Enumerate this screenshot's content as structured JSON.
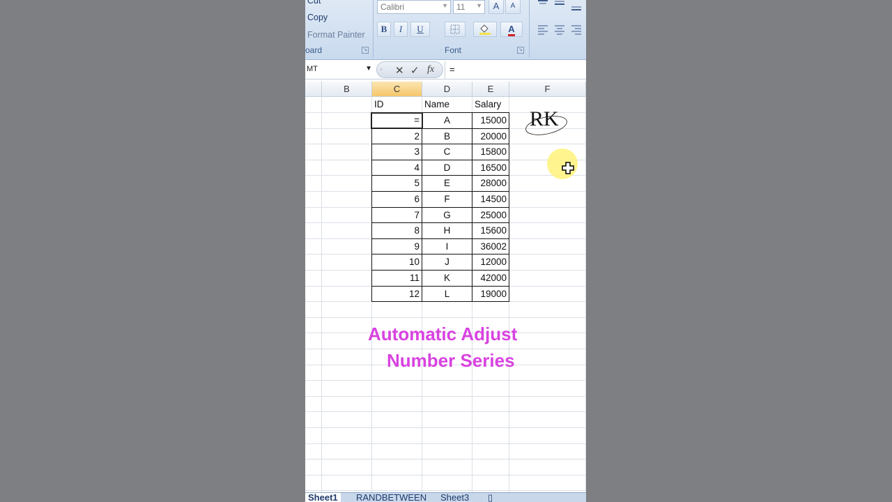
{
  "ribbon": {
    "clipboard": {
      "cut": "Cut",
      "copy": "Copy",
      "format_painter": "Format Painter",
      "group_label": "oard"
    },
    "font": {
      "font_name": "Calibri",
      "font_size": "11",
      "bold": "B",
      "italic": "I",
      "underline": "U",
      "group_label": "Font"
    }
  },
  "formula_bar": {
    "name_box": "MT",
    "formula": "="
  },
  "columns": [
    "B",
    "C",
    "D",
    "E",
    "F"
  ],
  "active_column": "C",
  "table": {
    "headers": [
      "ID",
      "Name",
      "Salary"
    ],
    "rows": [
      [
        "=",
        "A",
        "15000"
      ],
      [
        "2",
        "B",
        "20000"
      ],
      [
        "3",
        "C",
        "15800"
      ],
      [
        "4",
        "D",
        "16500"
      ],
      [
        "5",
        "E",
        "28000"
      ],
      [
        "6",
        "F",
        "14500"
      ],
      [
        "7",
        "G",
        "25000"
      ],
      [
        "8",
        "H",
        "15600"
      ],
      [
        "9",
        "I",
        "36002"
      ],
      [
        "10",
        "J",
        "12000"
      ],
      [
        "11",
        "K",
        "42000"
      ],
      [
        "12",
        "L",
        "19000"
      ]
    ]
  },
  "overlay": {
    "line1": "Automatic Adjust",
    "line2": "Number Series"
  },
  "logo_text": "RK",
  "sheet_tabs": [
    "Sheet1",
    "RANDBETWEEN",
    "Sheet3"
  ],
  "active_sheet": "Sheet1",
  "colors": {
    "overlay_text": "#d843e0",
    "active_header": "#f5c66a",
    "highlight": "#fff27a"
  }
}
